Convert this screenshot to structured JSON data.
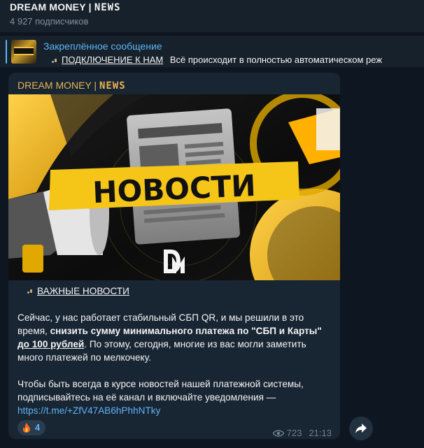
{
  "header": {
    "channel_name": "DREAM MONEY |",
    "channel_name_suffix": "NEWS",
    "subscribers": "4 927 подписчиков"
  },
  "pinned": {
    "label": "Закреплённое сообщение",
    "link_text": "ПОДКЛЮЧЕНИЕ К НАМ",
    "preview": "Всё происходит в полностью автоматическом реж"
  },
  "post": {
    "author": "DREAM MONEY |",
    "author_suffix": "NEWS",
    "image_banner_text": "НОВОСТИ",
    "heading": "ВАЖНЫЕ НОВОСТИ",
    "paragraph1_a": "Сейчас, у нас работает стабильный СБП QR, и мы решили в это время, ",
    "paragraph1_bold": "снизить сумму минимального платежа по \"СБП и Карты\"",
    "paragraph1_space": " ",
    "paragraph1_bold_underlined": "до 100 рублей",
    "paragraph1_b": ". По этому, сегодня, многие из вас могли заметить много платежей по мелкочеку.",
    "paragraph2": "Чтобы быть всегда в курсе новостей нашей платежной системы, подписывайтесь на её канал и включайте уведомления — ",
    "link": "https://t.me/+ZfV47AB6hPhhNTky",
    "reaction_count": "4",
    "views": "723",
    "time": "21:13"
  },
  "icons": {
    "reaction": "fire-icon",
    "views": "eye-icon",
    "share": "share-arrow-icon"
  },
  "colors": {
    "background": "#0e1621",
    "panel": "#17212b",
    "bubble": "#182533",
    "accent": "#5eb5f7",
    "author": "#e8b454",
    "banner_yellow": "#f5c518"
  }
}
